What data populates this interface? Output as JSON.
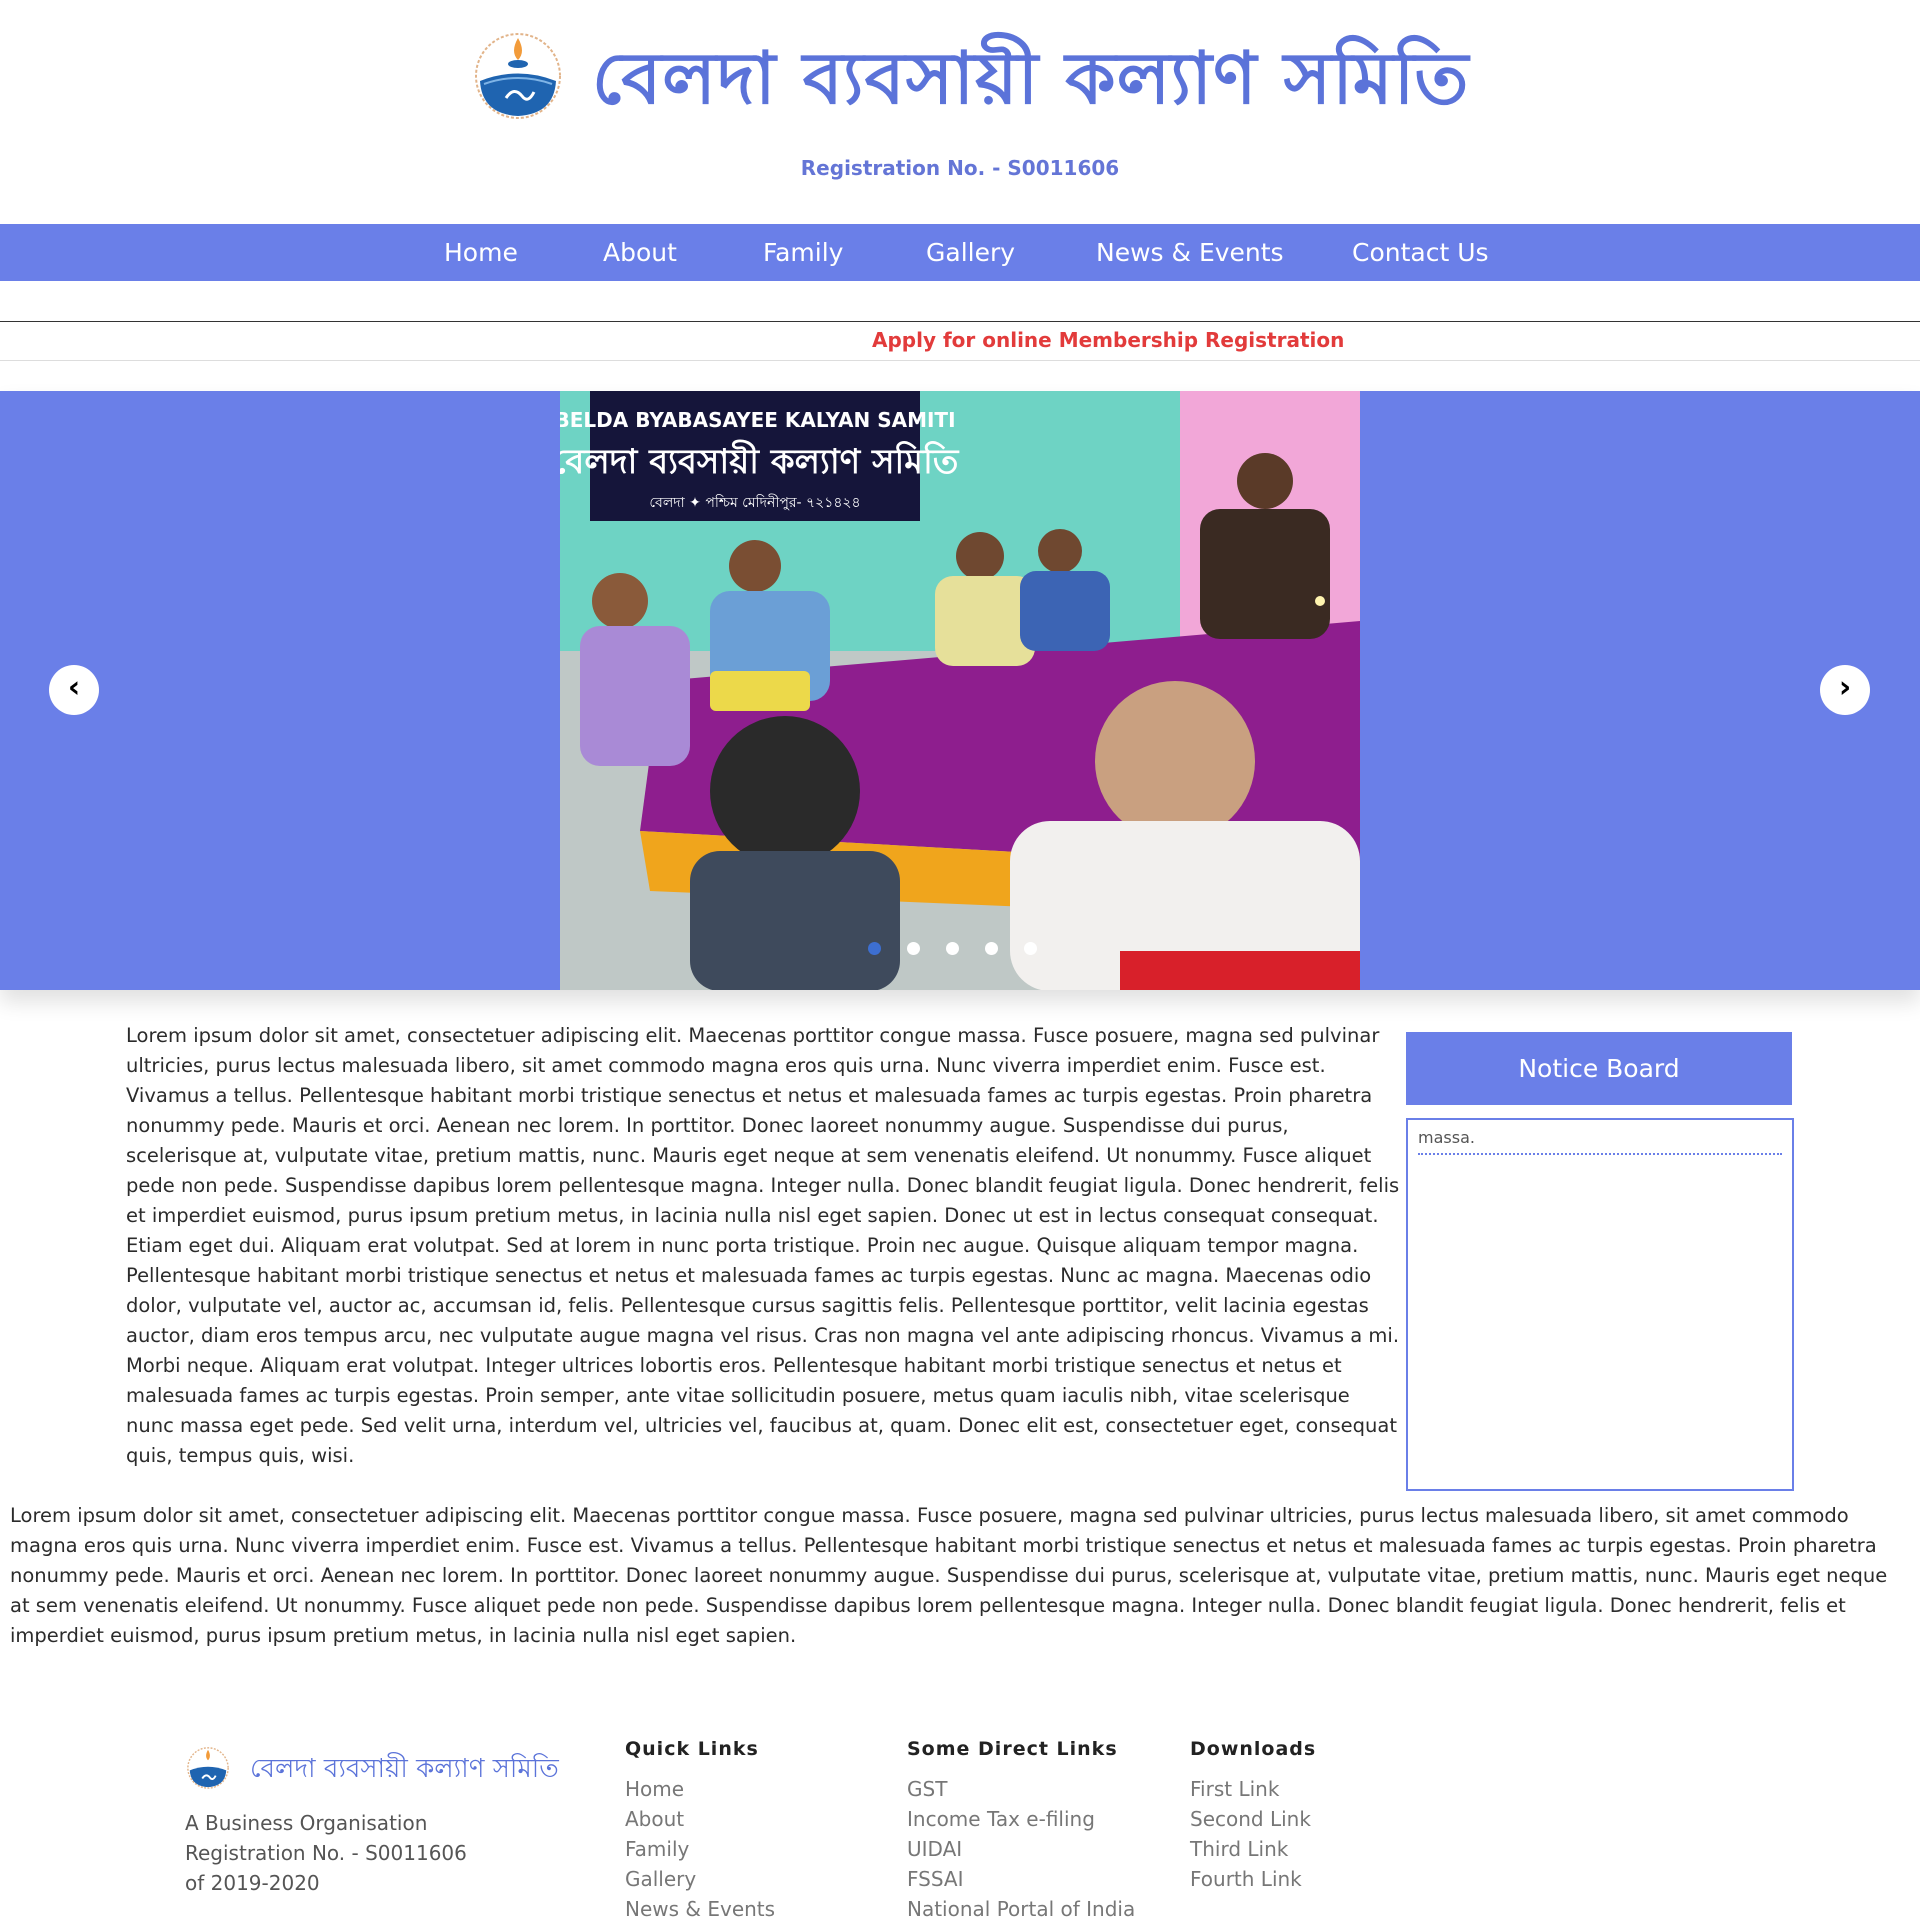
{
  "header": {
    "title": "বেলদা ব্যবসায়ী কল্যাণ সমিতি",
    "registration": "Registration No. - S0011606"
  },
  "nav": {
    "items": [
      "Home",
      "About",
      "Family",
      "Gallery",
      "News & Events",
      "Contact Us"
    ]
  },
  "announcement": "Apply for online Membership Registration",
  "slider": {
    "prev_label": "‹",
    "next_label": "›",
    "banner_line1": "BELDA BYABASAYEE KALYAN SAMITI",
    "banner_line2": "বেলদা ব্যবসায়ী কল্যাণ সমিতি",
    "banner_line3": "বেলদা ✦ পশ্চিম মেদিনীপুর- ৭২১৪২৪",
    "slide_count": 5,
    "active_index": 0
  },
  "main": {
    "text": "Lorem ipsum dolor sit amet, consectetuer adipiscing elit. Maecenas porttitor congue massa. Fusce posuere, magna sed pulvinar ultricies, purus lectus malesuada libero, sit amet commodo magna eros quis urna. Nunc viverra imperdiet enim. Fusce est. Vivamus a tellus. Pellentesque habitant morbi tristique senectus et netus et malesuada fames ac turpis egestas. Proin pharetra nonummy pede. Mauris et orci. Aenean nec lorem. In porttitor. Donec laoreet nonummy augue. Suspendisse dui purus, scelerisque at, vulputate vitae, pretium mattis, nunc. Mauris eget neque at sem venenatis eleifend. Ut nonummy. Fusce aliquet pede non pede. Suspendisse dapibus lorem pellentesque magna. Integer nulla. Donec blandit feugiat ligula. Donec hendrerit, felis et imperdiet euismod, purus ipsum pretium metus, in lacinia nulla nisl eget sapien. Donec ut est in lectus consequat consequat. Etiam eget dui. Aliquam erat volutpat. Sed at lorem in nunc porta tristique. Proin nec augue. Quisque aliquam tempor magna. Pellentesque habitant morbi tristique senectus et netus et malesuada fames ac turpis egestas. Nunc ac magna. Maecenas odio dolor, vulputate vel, auctor ac, accumsan id, felis. Pellentesque cursus sagittis felis. Pellentesque porttitor, velit lacinia egestas auctor, diam eros tempus arcu, nec vulputate augue magna vel risus. Cras non magna vel ante adipiscing rhoncus. Vivamus a mi. Morbi neque. Aliquam erat volutpat. Integer ultrices lobortis eros. Pellentesque habitant morbi tristique senectus et netus et malesuada fames ac turpis egestas. Proin semper, ante vitae sollicitudin posuere, metus quam iaculis nibh, vitae scelerisque nunc massa eget pede. Sed velit urna, interdum vel, ultricies vel, faucibus at, quam. Donec elit est, consectetuer eget, consequat quis, tempus quis, wisi."
  },
  "notice_board": {
    "title": "Notice Board",
    "items": [
      "massa."
    ]
  },
  "secondary": {
    "text": "Lorem ipsum dolor sit amet, consectetuer adipiscing elit. Maecenas porttitor congue massa. Fusce posuere, magna sed pulvinar ultricies, purus lectus malesuada libero, sit amet commodo magna eros quis urna. Nunc viverra imperdiet enim. Fusce est. Vivamus a tellus. Pellentesque habitant morbi tristique senectus et netus et malesuada fames ac turpis egestas. Proin pharetra nonummy pede. Mauris et orci. Aenean nec lorem. In porttitor. Donec laoreet nonummy augue. Suspendisse dui purus, scelerisque at, vulputate vitae, pretium mattis, nunc. Mauris eget neque at sem venenatis eleifend. Ut nonummy. Fusce aliquet pede non pede. Suspendisse dapibus lorem pellentesque magna. Integer nulla. Donec blandit feugiat ligula. Donec hendrerit, felis et imperdiet euismod, purus ipsum pretium metus, in lacinia nulla nisl eget sapien."
  },
  "footer": {
    "title": "বেলদা ব্যবসায়ী কল্যাণ সমিতি",
    "description": "A Business Organisation Registration No. - S0011606 of 2019-2020",
    "quick_links": {
      "heading": "Quick Links",
      "items": [
        "Home",
        "About",
        "Family",
        "Gallery",
        "News & Events"
      ]
    },
    "direct_links": {
      "heading": "Some Direct Links",
      "items": [
        "GST",
        "Income Tax e-filing",
        "UIDAI",
        "FSSAI",
        "National Portal of India"
      ]
    },
    "downloads": {
      "heading": "Downloads",
      "items": [
        "First Link",
        "Second Link",
        "Third Link",
        "Fourth Link"
      ]
    }
  },
  "colors": {
    "brand": "#6a7fe8",
    "title": "#5b73d9",
    "alert": "#e23b3b"
  }
}
